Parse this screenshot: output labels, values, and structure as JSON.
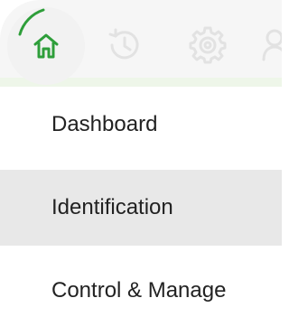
{
  "colors": {
    "accent": "#2e9e3a",
    "active_row": "#e8e8e8",
    "icon_faded": "#e4e4e4"
  },
  "toolbar": {
    "icons": [
      "home-icon",
      "history-icon",
      "gear-icon",
      "user-icon"
    ],
    "selected": "home-icon"
  },
  "menu": {
    "items": [
      {
        "label": "Dashboard"
      },
      {
        "label": "Identification"
      },
      {
        "label": "Control & Manage"
      }
    ],
    "highlighted_index": 1
  }
}
